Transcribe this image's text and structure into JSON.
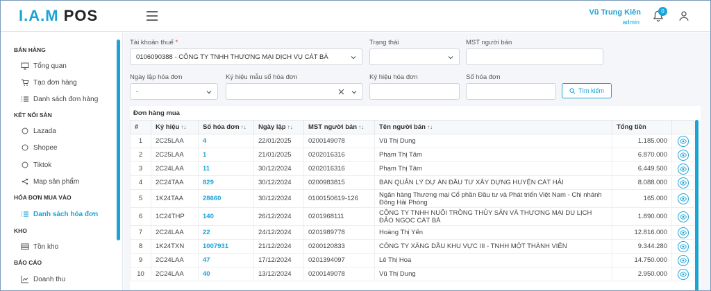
{
  "header": {
    "logo_part1": "I.A.M",
    "logo_part2": "POS",
    "user_name": "Vũ Trung Kiên",
    "user_role": "admin",
    "notification_count": "0"
  },
  "sidebar": {
    "sections": [
      {
        "title": "BÁN HÀNG",
        "items": [
          {
            "label": "Tổng quan",
            "icon": "monitor-icon"
          },
          {
            "label": "Tạo đơn hàng",
            "icon": "cart-icon"
          },
          {
            "label": "Danh sách đơn hàng",
            "icon": "list-icon"
          }
        ]
      },
      {
        "title": "KẾT NỐI SÀN",
        "items": [
          {
            "label": "Lazada",
            "icon": "circle-icon"
          },
          {
            "label": "Shopee",
            "icon": "circle-icon"
          },
          {
            "label": "Tiktok",
            "icon": "circle-icon"
          },
          {
            "label": "Map sản phẩm",
            "icon": "share-icon"
          }
        ]
      },
      {
        "title": "HÓA ĐƠN MUA VÀO",
        "items": [
          {
            "label": "Danh sách hóa đơn",
            "icon": "list-icon",
            "active": true
          }
        ]
      },
      {
        "title": "KHO",
        "items": [
          {
            "label": "Tồn kho",
            "icon": "warehouse-icon"
          }
        ]
      },
      {
        "title": "BÁO CÁO",
        "items": [
          {
            "label": "Doanh thu",
            "icon": "chart-icon"
          }
        ]
      }
    ]
  },
  "filters": {
    "tax_account_label": "Tài khoản thuế",
    "tax_account_required": "*",
    "tax_account_value": "0106090388 - CÔNG TY TNHH THƯƠNG MẠI DỊCH VỤ CÁT BÀ",
    "status_label": "Trạng thái",
    "status_value": "",
    "seller_tax_label": "MST người bán",
    "seller_tax_value": "",
    "invoice_date_label": "Ngày lập hóa đơn",
    "invoice_date_value": "-",
    "template_symbol_label": "Ký hiệu mẫu số hóa đơn",
    "template_symbol_value": "",
    "invoice_symbol_label": "Ký hiệu hóa đơn",
    "invoice_symbol_value": "",
    "invoice_number_label": "Số hóa đơn",
    "invoice_number_value": "",
    "search_button": "Tìm kiếm"
  },
  "table": {
    "title": "Đơn hàng mua",
    "columns": [
      "#",
      "Ký hiệu",
      "Số hóa đơn",
      "Ngày lập",
      "MST người bán",
      "Tên người bán",
      "Tổng tiền"
    ],
    "rows": [
      {
        "no": "1",
        "symbol": "2C25LAA",
        "number": "4",
        "date": "22/01/2025",
        "tax": "0200149078",
        "seller": "Vũ Thị Dung",
        "total": "1.185.000"
      },
      {
        "no": "2",
        "symbol": "2C25LAA",
        "number": "1",
        "date": "21/01/2025",
        "tax": "0202016316",
        "seller": "Phạm Thị Tâm",
        "total": "6.870.000"
      },
      {
        "no": "3",
        "symbol": "2C24LAA",
        "number": "11",
        "date": "30/12/2024",
        "tax": "0202016316",
        "seller": "Phạm Thị Tâm",
        "total": "6.449.500"
      },
      {
        "no": "4",
        "symbol": "2C24TAA",
        "number": "829",
        "date": "30/12/2024",
        "tax": "0200983815",
        "seller": "BAN QUẢN LÝ DỰ ÁN ĐẦU TƯ XÂY DỰNG HUYỆN CÁT HẢI",
        "total": "8.088.000"
      },
      {
        "no": "5",
        "symbol": "1K24TAA",
        "number": "28660",
        "date": "30/12/2024",
        "tax": "0100150619-126",
        "seller": "Ngân hàng Thương mại Cổ phần Đầu tư và Phát triển Việt Nam - Chi nhánh Đông Hải Phòng",
        "total": "165.000"
      },
      {
        "no": "6",
        "symbol": "1C24THP",
        "number": "140",
        "date": "26/12/2024",
        "tax": "0201968111",
        "seller": "CÔNG TY TNHH NUÔI TRỒNG THỦY SẢN VÀ THƯƠNG MẠI DU LỊCH ĐẢO NGỌC CÁT BÀ",
        "total": "1.890.000"
      },
      {
        "no": "7",
        "symbol": "2C24LAA",
        "number": "22",
        "date": "24/12/2024",
        "tax": "0201989778",
        "seller": "Hoàng Thị Yến",
        "total": "12.816.000"
      },
      {
        "no": "8",
        "symbol": "1K24TXN",
        "number": "1007931",
        "date": "21/12/2024",
        "tax": "0200120833",
        "seller": "CÔNG TY XĂNG DẦU KHU VỰC III - TNHH MỘT THÀNH VIÊN",
        "total": "9.344.280"
      },
      {
        "no": "9",
        "symbol": "2C24LAA",
        "number": "47",
        "date": "17/12/2024",
        "tax": "0201394097",
        "seller": "Lê Thị Hoa",
        "total": "14.750.000"
      },
      {
        "no": "10",
        "symbol": "2C24LAA",
        "number": "40",
        "date": "13/12/2024",
        "tax": "0200149078",
        "seller": "Vũ Thị Dung",
        "total": "2.950.000"
      }
    ]
  },
  "colors": {
    "accent": "#1aa3d6"
  }
}
